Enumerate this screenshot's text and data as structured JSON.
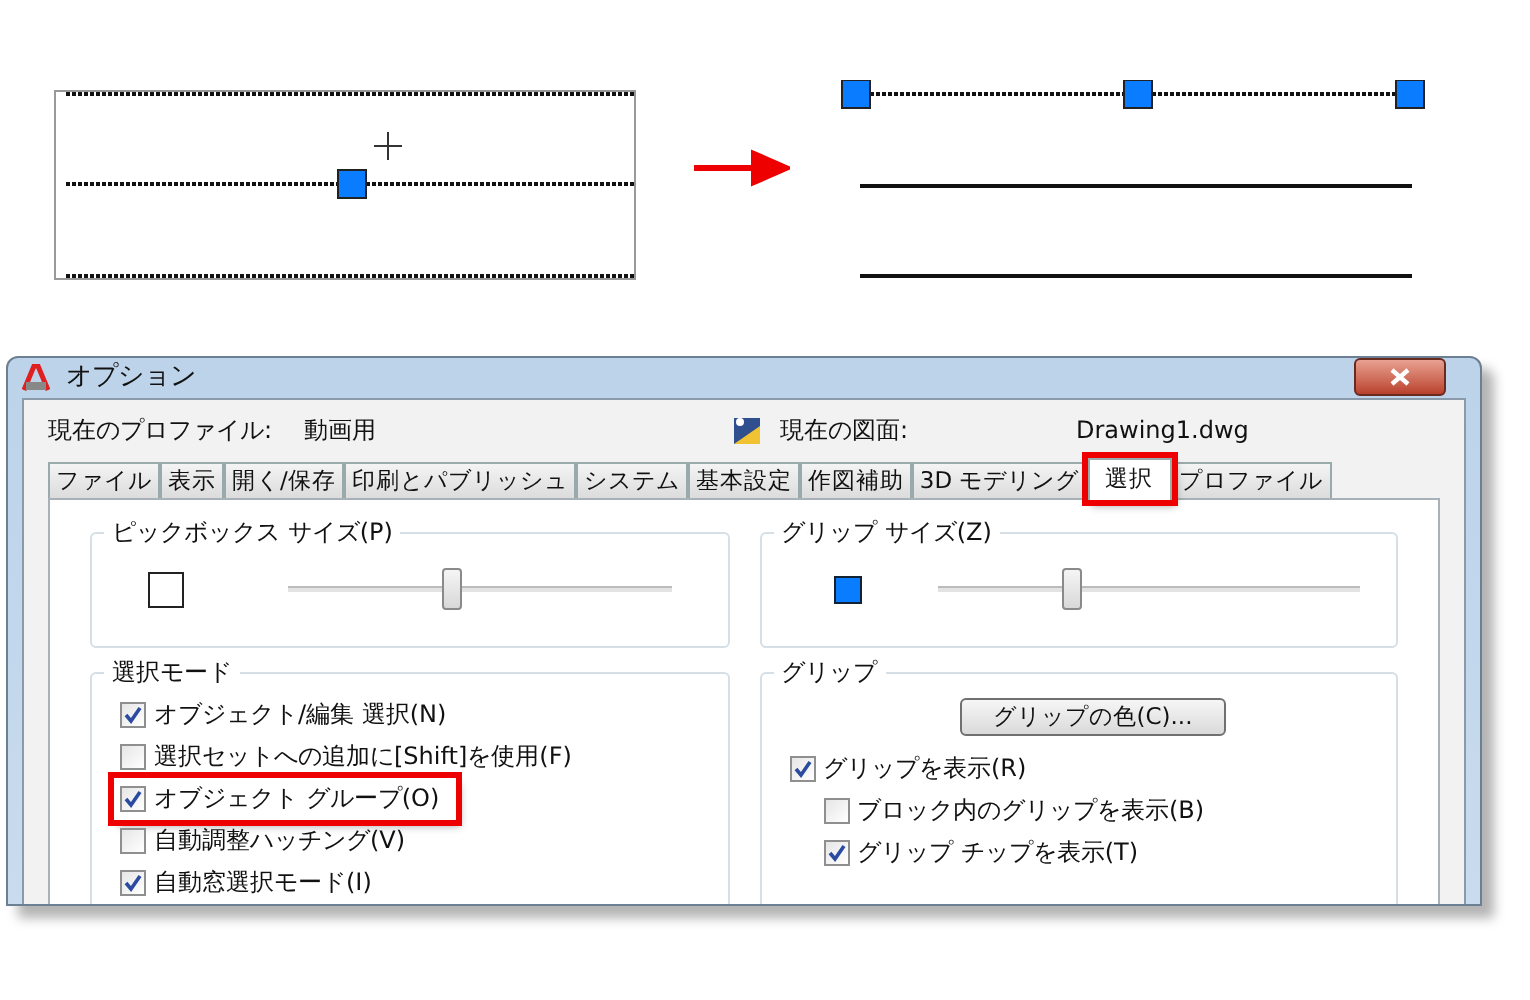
{
  "window": {
    "title": "オプション"
  },
  "profile": {
    "label": "現在のプロファイル:",
    "value": "動画用"
  },
  "drawing": {
    "label": "現在の図面:",
    "value": "Drawing1.dwg"
  },
  "tabs": [
    {
      "label": "ファイル",
      "selected": false,
      "highlighted": false
    },
    {
      "label": "表示",
      "selected": false,
      "highlighted": false
    },
    {
      "label": "開く/保存",
      "selected": false,
      "highlighted": false
    },
    {
      "label": "印刷とパブリッシュ",
      "selected": false,
      "highlighted": false
    },
    {
      "label": "システム",
      "selected": false,
      "highlighted": false
    },
    {
      "label": "基本設定",
      "selected": false,
      "highlighted": false
    },
    {
      "label": "作図補助",
      "selected": false,
      "highlighted": false
    },
    {
      "label": "3D モデリング",
      "selected": false,
      "highlighted": false
    },
    {
      "label": "選択",
      "selected": true,
      "highlighted": true
    },
    {
      "label": "プロファイル",
      "selected": false,
      "highlighted": false
    }
  ],
  "pickbox_size": {
    "title": "ピックボックス サイズ(P)",
    "level": 0.43
  },
  "grip_size": {
    "title": "グリップ サイズ(Z)",
    "level": 0.32
  },
  "selection_mode": {
    "title": "選択モード",
    "options": [
      {
        "label": "オブジェクト/編集 選択(N)",
        "checked": true,
        "highlighted": false
      },
      {
        "label": "選択セットへの追加に[Shift]を使用(F)",
        "checked": false,
        "highlighted": false
      },
      {
        "label": "オブジェクト グループ(O)",
        "checked": true,
        "highlighted": true
      },
      {
        "label": "自動調整ハッチング(V)",
        "checked": false,
        "highlighted": false
      },
      {
        "label": "自動窓選択モード(I)",
        "checked": true,
        "highlighted": false
      }
    ]
  },
  "grips": {
    "title": "グリップ",
    "button": "グリップの色(C)...",
    "options": [
      {
        "label": "グリップを表示(R)",
        "checked": true,
        "highlighted": false,
        "children": [
          {
            "label": "ブロック内のグリップを表示(B)",
            "checked": false,
            "highlighted": false
          },
          {
            "label": "グリップ チップを表示(T)",
            "checked": true,
            "highlighted": false
          }
        ]
      }
    ]
  }
}
